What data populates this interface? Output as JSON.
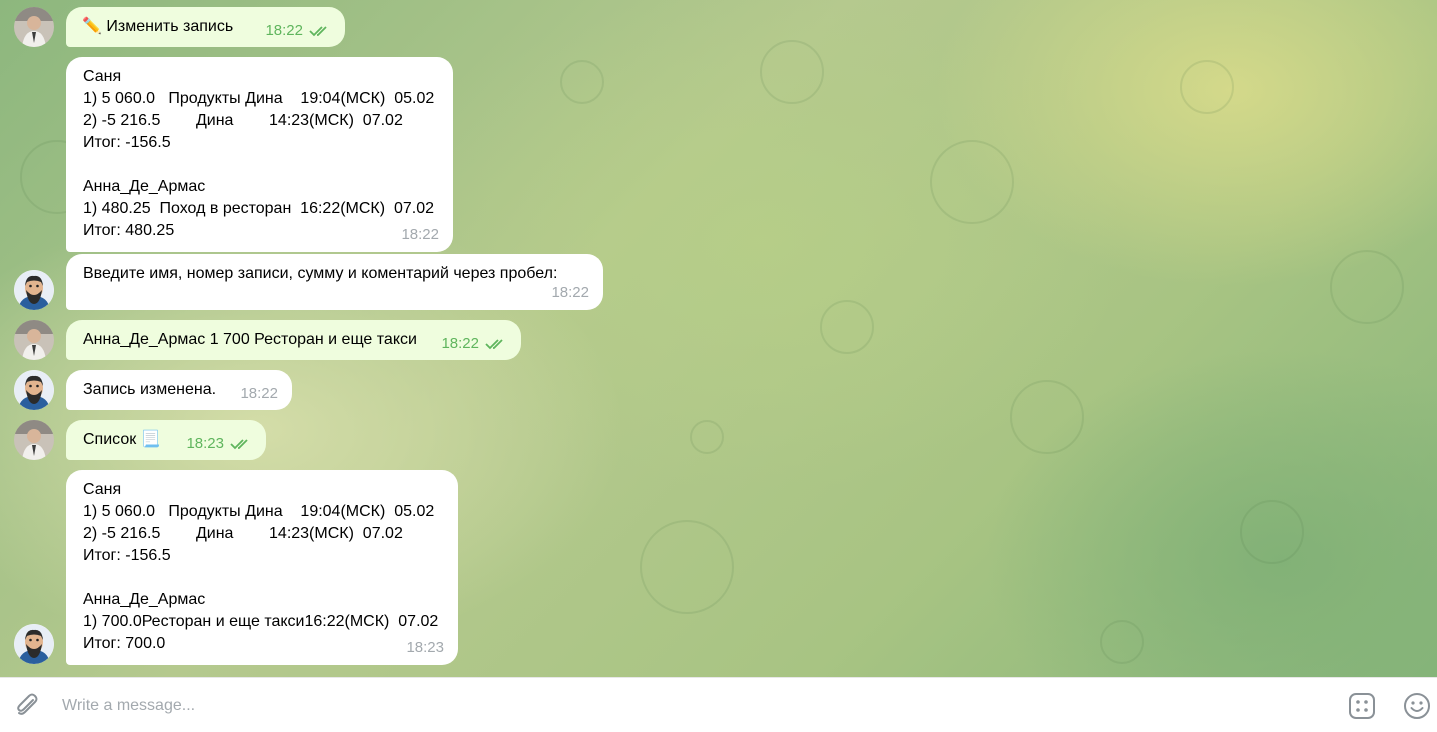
{
  "composer": {
    "placeholder": "Write a message...",
    "icons": [
      "paperclip-icon",
      "bot-commands-icon",
      "emoji-icon"
    ]
  },
  "colors": {
    "incoming_bubble": "#ffffff",
    "outgoing_bubble": "#effdde",
    "outgoing_meta": "#5fb55d",
    "incoming_meta": "#a3a9ae"
  },
  "messages": [
    {
      "sender": "user",
      "text": "✏️ Изменить запись",
      "time": "18:22",
      "read": true
    },
    {
      "sender": "bot",
      "text": "Саня\n1) 5 060.0   Продукты Дина    19:04(МСК)  05.02\n2) -5 216.5        Дина        14:23(МСК)  07.02\nИтог: -156.5\n\nАнна_Де_Армас\n1) 480.25  Поход в ресторан  16:22(МСК)  07.02\nИтог: 480.25",
      "time": "18:22"
    },
    {
      "sender": "bot",
      "text": "Введите имя, номер записи, сумму и коментарий через пробел:",
      "time": "18:22"
    },
    {
      "sender": "user",
      "text": "Анна_Де_Армас 1 700 Ресторан и еще такси",
      "time": "18:22",
      "read": true
    },
    {
      "sender": "bot",
      "text": "Запись изменена.",
      "time": "18:22"
    },
    {
      "sender": "user",
      "text": "Список 📃",
      "time": "18:23",
      "read": true
    },
    {
      "sender": "bot",
      "text": "Саня\n1) 5 060.0   Продукты Дина    19:04(МСК)  05.02\n2) -5 216.5        Дина        14:23(МСК)  07.02\nИтог: -156.5\n\nАнна_Де_Армас\n1) 700.0Ресторан и еще такси16:22(МСК)  07.02\nИтог: 700.0",
      "time": "18:23"
    }
  ]
}
